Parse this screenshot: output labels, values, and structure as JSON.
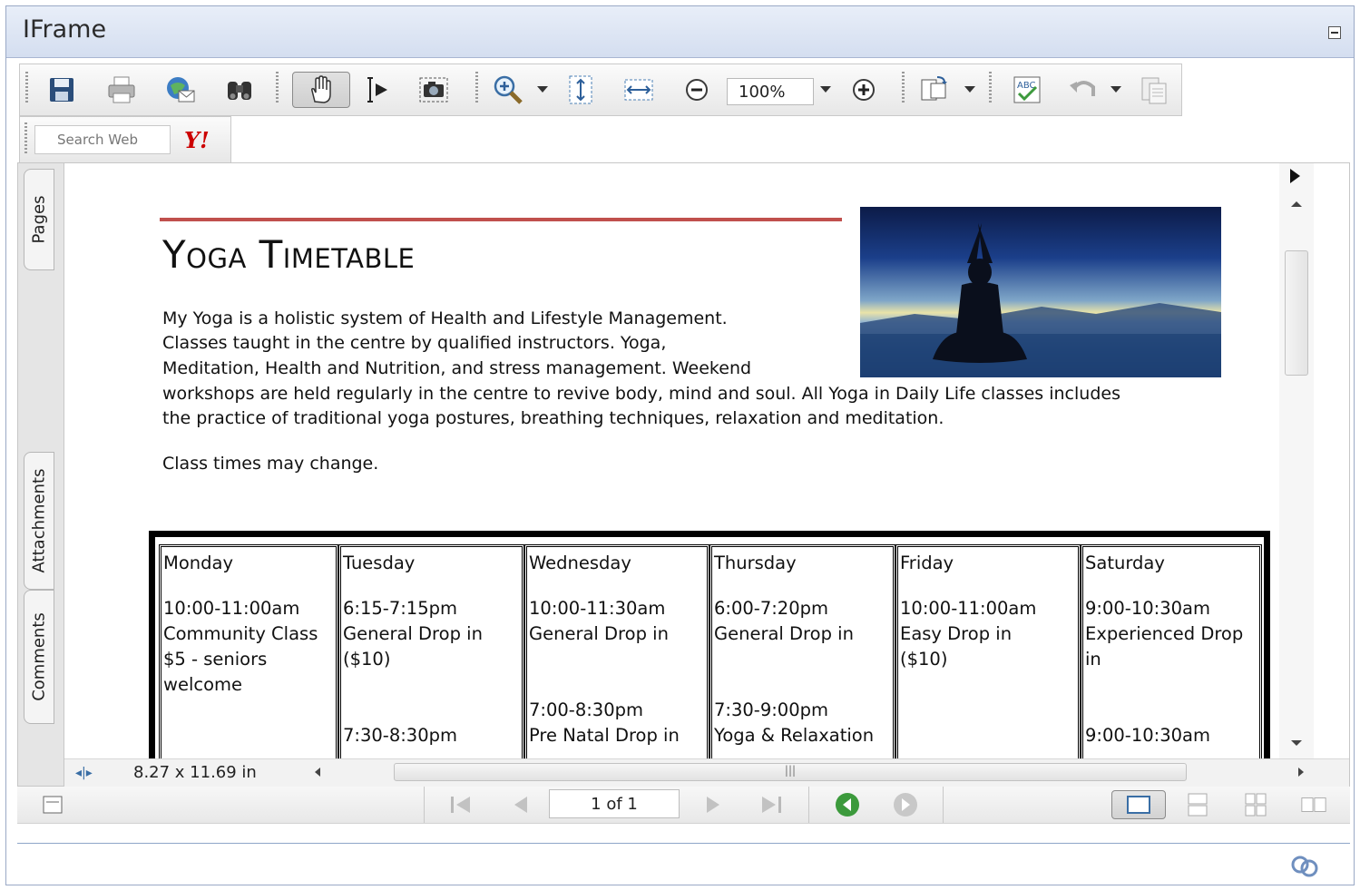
{
  "window": {
    "title": "IFrame"
  },
  "toolbar": {
    "zoom_value": "100%",
    "search_placeholder": "Search Web",
    "yahoo_logo": "Y!"
  },
  "sidebar": {
    "tabs": [
      "Pages",
      "Attachments",
      "Comments"
    ]
  },
  "status": {
    "page_size": "8.27 x 11.69 in",
    "page_indicator": "1 of 1"
  },
  "document": {
    "heading": "Yoga Timetable",
    "paragraph_lines": [
      "My Yoga is a holistic system of Health and Lifestyle Management.",
      "Classes taught in the centre by qualified instructors. Yoga,",
      "Meditation, Health and Nutrition, and stress management. Weekend",
      "workshops are held regularly in the centre to revive body, mind and soul. All Yoga in Daily Life classes includes",
      "the practice of traditional yoga postures, breathing techniques, relaxation and meditation."
    ],
    "note": "Class times may change.",
    "schedule": [
      {
        "day": "Monday",
        "text": "10:00-11:00am\nCommunity Class\n$5 - seniors\nwelcome"
      },
      {
        "day": "Tuesday",
        "text": "6:15-7:15pm\nGeneral Drop in\n($10)\n\n\n7:30-8:30pm"
      },
      {
        "day": "Wednesday",
        "text": "10:00-11:30am\nGeneral Drop in\n\n\n7:00-8:30pm\nPre Natal Drop in"
      },
      {
        "day": "Thursday",
        "text": "6:00-7:20pm\nGeneral Drop in\n\n\n7:30-9:00pm\nYoga & Relaxation"
      },
      {
        "day": "Friday",
        "text": "10:00-11:00am\nEasy Drop in\n($10)"
      },
      {
        "day": "Saturday",
        "text": "9:00-10:30am\nExperienced Drop\nin\n\n\n9:00-10:30am"
      }
    ]
  }
}
